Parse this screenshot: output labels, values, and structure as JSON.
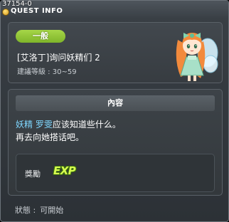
{
  "window": {
    "quest_id": "37154-0",
    "title": "QUEST INFO"
  },
  "quest": {
    "grade": "一般",
    "name": "[艾洛丁]询问妖精们 2",
    "level_range": "建議等級 : 30~59"
  },
  "content": {
    "header": "內容",
    "npc_label": "妖精",
    "npc_name": "罗雯",
    "line1_rest": "应该知道些什么。",
    "line2": "再去向她搭话吧。"
  },
  "reward": {
    "label": "獎勵",
    "type": "EXP"
  },
  "status": {
    "label": "狀態 :",
    "value": "可開始"
  },
  "colors": {
    "badge_green": "#8fc43a",
    "npc_name_blue": "#7fd7ff",
    "exp_green": "#d8ff50"
  },
  "icons": {
    "title_icon": "quest-coin-icon",
    "npc_portrait": "fairy-npc-portrait",
    "reward_icon": "exp-icon"
  }
}
